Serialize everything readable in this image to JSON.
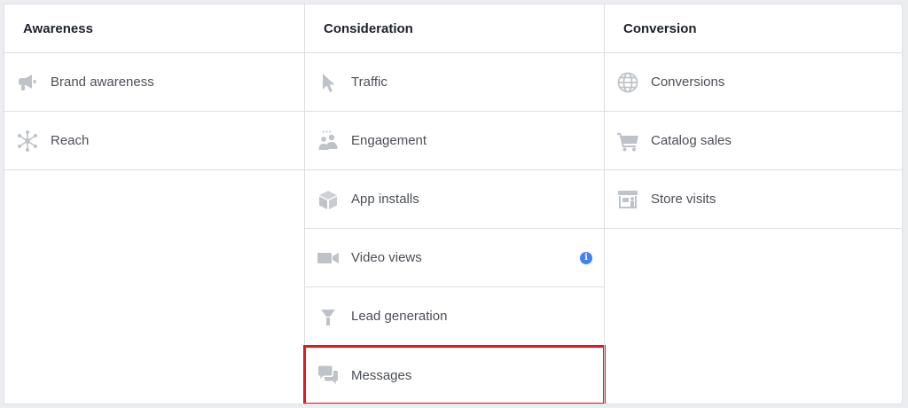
{
  "columns": [
    {
      "header": "Awareness",
      "items": [
        {
          "label": "Brand awareness",
          "icon": "megaphone-icon"
        },
        {
          "label": "Reach",
          "icon": "network-icon"
        }
      ]
    },
    {
      "header": "Consideration",
      "items": [
        {
          "label": "Traffic",
          "icon": "cursor-icon"
        },
        {
          "label": "Engagement",
          "icon": "people-icon"
        },
        {
          "label": "App installs",
          "icon": "cube-icon"
        },
        {
          "label": "Video views",
          "icon": "video-camera-icon",
          "info": "i"
        },
        {
          "label": "Lead generation",
          "icon": "funnel-icon"
        },
        {
          "label": "Messages",
          "icon": "chat-bubbles-icon",
          "selected": true
        }
      ]
    },
    {
      "header": "Conversion",
      "items": [
        {
          "label": "Conversions",
          "icon": "globe-icon"
        },
        {
          "label": "Catalog sales",
          "icon": "shopping-cart-icon"
        },
        {
          "label": "Store visits",
          "icon": "storefront-icon"
        }
      ]
    }
  ],
  "colors": {
    "icon": "#bec3c9",
    "border": "#dddfe2",
    "info": "#4080ff",
    "selected_outline": "#e4161f"
  }
}
